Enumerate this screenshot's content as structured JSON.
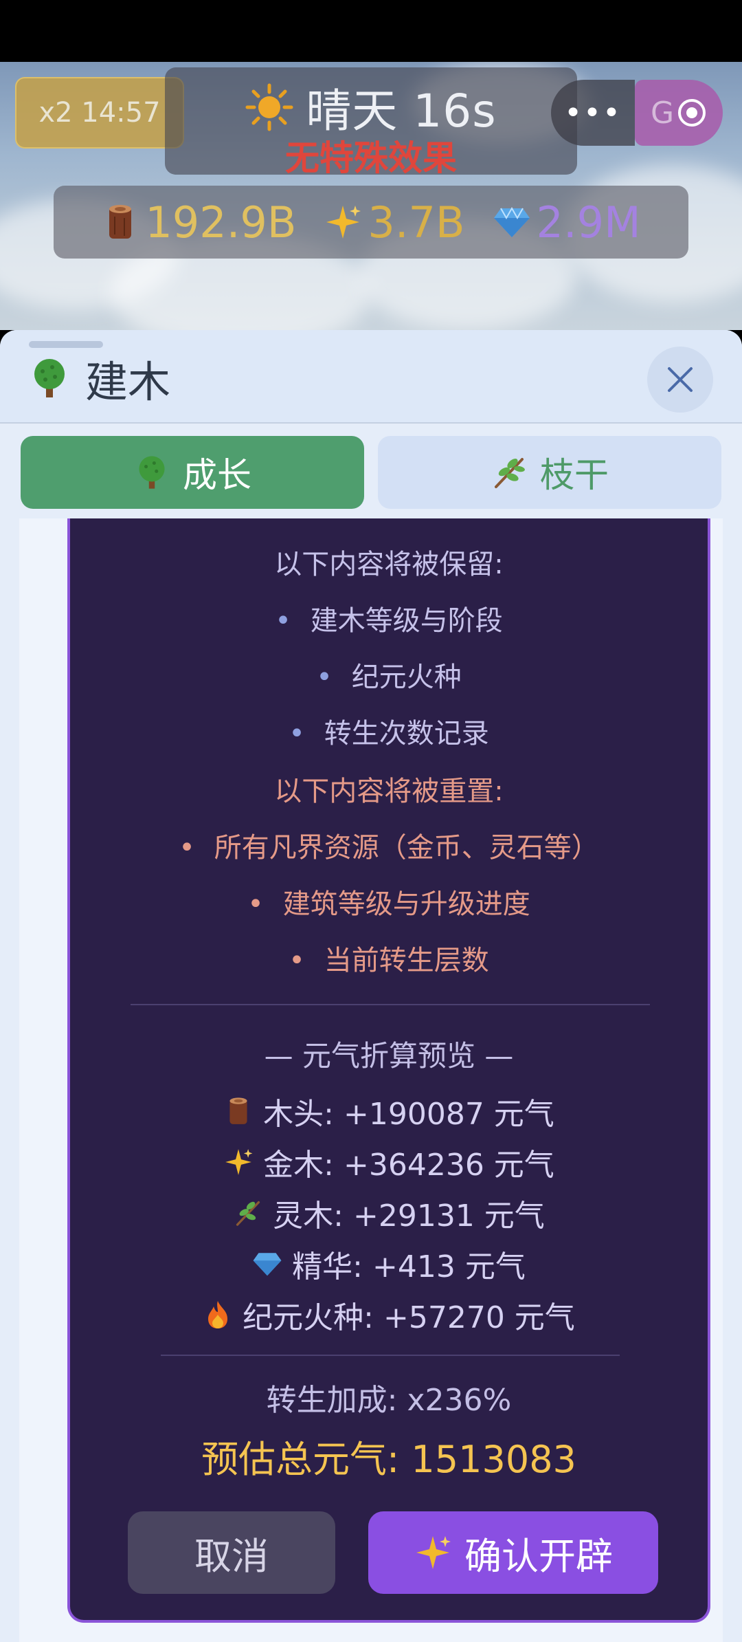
{
  "header": {
    "speed_badge": "x2 14:57",
    "weather": "晴天 16s",
    "weather_effect": "无特殊效果",
    "capsule_more": "•••",
    "capsule_label": "G",
    "resources": [
      {
        "icon": "wood-log-icon",
        "value": "192.9B"
      },
      {
        "icon": "sparkle-icon",
        "value": "3.7B"
      },
      {
        "icon": "gem-icon",
        "value": "2.9M"
      }
    ]
  },
  "panel": {
    "title": "建木",
    "tabs": [
      {
        "label": "成长",
        "icon": "tree-icon",
        "active": true
      },
      {
        "label": "枝干",
        "icon": "branch-icon",
        "active": false
      }
    ]
  },
  "dialog": {
    "keep_header": "以下内容将被保留:",
    "keep_items": [
      "建木等级与阶段",
      "纪元火种",
      "转生次数记录"
    ],
    "reset_header": "以下内容将被重置:",
    "reset_items": [
      "所有凡界资源（金币、灵石等）",
      "建筑等级与升级进度",
      "当前转生层数"
    ],
    "preview_title": "— 元气折算预览 —",
    "conversions": [
      {
        "icon": "wood-log-icon",
        "text": "木头: +190087 元气"
      },
      {
        "icon": "sparkle-icon",
        "text": "金木: +364236 元气"
      },
      {
        "icon": "branch-icon",
        "text": "灵木: +29131 元气"
      },
      {
        "icon": "gem-icon",
        "text": "精华: +413 元气"
      },
      {
        "icon": "fire-icon",
        "text": "纪元火种: +57270 元气"
      }
    ],
    "bonus": "转生加成: x236%",
    "total": "预估总元气: 1513083",
    "cancel_label": "取消",
    "confirm_label": "确认开辟"
  },
  "colors": {
    "dialog_bg": "#2b1f48",
    "accent_purple": "#8a4fe2",
    "tab_active_green": "#4f9e6e",
    "total_gold": "#f5c451",
    "reset_salmon": "#e59a88"
  }
}
